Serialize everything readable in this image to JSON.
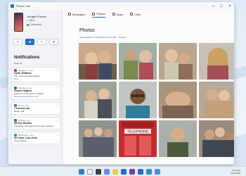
{
  "window": {
    "title": "Phone Link",
    "controls": [
      "—",
      "☐",
      "✕"
    ]
  },
  "phone": {
    "name": "Jordan's Phone",
    "battery": "80%",
    "status": "Connected"
  },
  "quick_actions": [
    "⊝",
    "✱",
    "✎",
    "⚙"
  ],
  "notifications": {
    "title": "Notifications",
    "clear_label": "Clear all",
    "items": [
      {
        "app": "Instagram",
        "color": "#d6367a",
        "time": "now",
        "name": "Dylan Williams",
        "text": "Your photo is looking great!",
        "link": "Like"
      },
      {
        "app": "Facebook",
        "color": "#1f6fd1",
        "time": "2m",
        "name": "Shawn Hughes",
        "text": "Awesome to be back in Seattle!",
        "link": "https://www.example.com/"
      },
      {
        "app": "Phone",
        "color": "#2a9d4a",
        "time": "5m",
        "name": "1 missed call",
        "text": "Return call",
        "link": ""
      },
      {
        "app": "Outlook",
        "color": "#1f6fd1",
        "time": "9m",
        "name": "Wesley Brooks",
        "text": "Thanks for the pictures from last weekend",
        "link": ""
      },
      {
        "app": "Messages",
        "color": "#1f9bd6",
        "time": "12m",
        "name": "Ali Khan, Lola Jules",
        "text": "Great photos!",
        "link": ""
      }
    ]
  },
  "tabs": [
    {
      "label": "Messages",
      "active": false
    },
    {
      "label": "Photos",
      "active": true
    },
    {
      "label": "Apps",
      "active": false
    },
    {
      "label": "Calls",
      "active": false
    }
  ],
  "photos": {
    "title": "Photos",
    "meta": "Last updated on 4/17/2023 at 11:11 AM",
    "refresh_label": "Refresh"
  },
  "taskbar": {
    "time": "11:11 AM",
    "date": "4/17/2023"
  }
}
